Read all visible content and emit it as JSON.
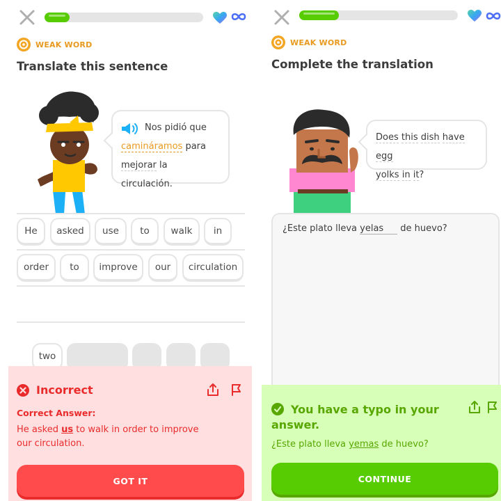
{
  "colors": {
    "green": "#58cc02",
    "red": "#ff4b4b",
    "orange": "#e79a1f",
    "gray": "#e5e5e5",
    "blue": "#1cb0f6"
  },
  "left": {
    "progress": 0.16,
    "badge": "WEAK WORD",
    "title": "Translate this sentence",
    "bubble": {
      "w1": "Nos",
      "w2": "pidió",
      "w3": "que",
      "w4": "camináramos",
      "w5": "para",
      "w6": "mejorar",
      "w7": "la",
      "w8": "circulación."
    },
    "word_bank": [
      "He",
      "asked",
      "use",
      "to",
      "walk",
      "in",
      "order",
      "to",
      "improve",
      "our",
      "circulation"
    ],
    "spare_chip": "two",
    "feedback": {
      "title": "Incorrect",
      "sub": "Correct Answer:",
      "answer_a": "He asked ",
      "answer_b": "us",
      "answer_c": " to walk in order to improve",
      "answer_d": "our circulation.",
      "button": "GOT IT"
    }
  },
  "right": {
    "progress": 0.25,
    "badge": "WEAK WORD",
    "title": "Complete the translation",
    "bubble": {
      "w1": "Does",
      "w2": "this",
      "w3": "dish",
      "w4": "have",
      "w5": "egg",
      "w6": "yolks",
      "w7": "in",
      "w8": "it",
      "w9": "?"
    },
    "prompt_a": "¿Este plato lleva ",
    "input_value": "yelas",
    "prompt_b": " de huevo?",
    "feedback": {
      "title_line1": "You have a typo in your",
      "title_line2": "answer.",
      "text_a": "¿Este plato lleva ",
      "text_b": "yemas",
      "text_c": " de huevo?",
      "button": "CONTINUE"
    }
  }
}
